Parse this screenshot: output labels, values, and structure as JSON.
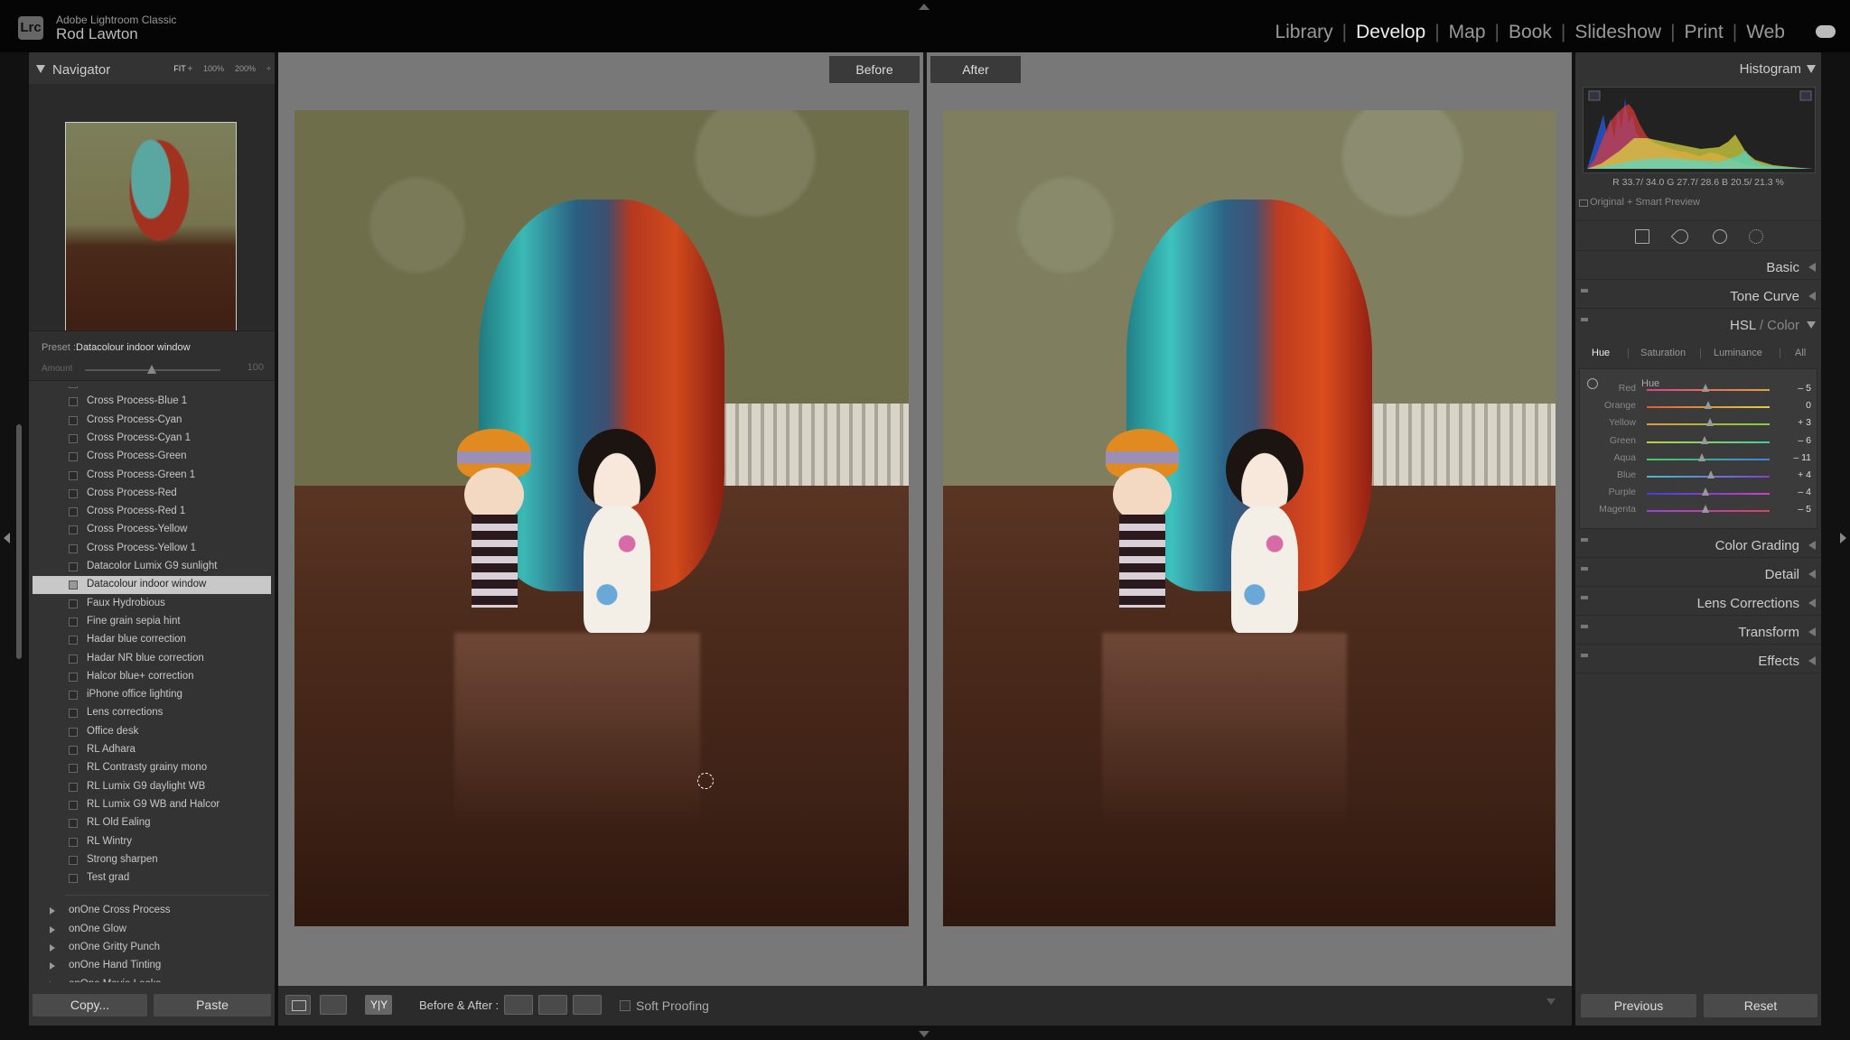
{
  "app": {
    "name": "Adobe Lightroom Classic",
    "user": "Rod Lawton",
    "logo_text": "Lrc"
  },
  "modules": [
    "Library",
    "Develop",
    "Map",
    "Book",
    "Slideshow",
    "Print",
    "Web"
  ],
  "active_module": "Develop",
  "navigator": {
    "title": "Navigator",
    "zoom_options": [
      "FIT ÷",
      "100%",
      "200%",
      "÷"
    ]
  },
  "preset": {
    "label": "Preset :",
    "name": "Datacolour indoor window",
    "amount_label": "Amount",
    "amount_value": "100"
  },
  "preset_items": [
    "Cross Process-Blue",
    "Cross Process-Blue 1",
    "Cross Process-Cyan",
    "Cross Process-Cyan 1",
    "Cross Process-Green",
    "Cross Process-Green 1",
    "Cross Process-Red",
    "Cross Process-Red 1",
    "Cross Process-Yellow",
    "Cross Process-Yellow 1",
    "Datacolor Lumix G9 sunlight",
    "Datacolour indoor window",
    "Faux Hydrobious",
    "Fine grain sepia hint",
    "Hadar blue correction",
    "Hadar NR blue correction",
    "Halcor blue+ correction",
    "iPhone office lighting",
    "Lens corrections",
    "Office desk",
    "RL Adhara",
    "RL Contrasty grainy mono",
    "RL Lumix G9 daylight WB",
    "RL Lumix G9 WB and Halcor",
    "RL Old Ealing",
    "RL Wintry",
    "Strong sharpen",
    "Test grad"
  ],
  "selected_preset": "Datacolour indoor window",
  "preset_groups": [
    "onOne Cross Process",
    "onOne Glow",
    "onOne Gritty Punch",
    "onOne Hand Tinting",
    "onOne Movie Looks"
  ],
  "left_buttons": {
    "copy": "Copy...",
    "paste": "Paste"
  },
  "view": {
    "before": "Before",
    "after": "After"
  },
  "toolbar": {
    "yy": "Y|Y",
    "before_after": "Before & After :",
    "soft_proofing": "Soft Proofing"
  },
  "histogram": {
    "title": "Histogram",
    "readout": "R  33.7/ 34.0   G  27.7/ 28.6   B  20.5/  21.3  %",
    "smart_preview": "Original + Smart Preview"
  },
  "sections": {
    "basic": "Basic",
    "tone_curve": "Tone Curve",
    "hsl": "HSL",
    "hsl_color": "/ Color",
    "color_grading": "Color Grading",
    "detail": "Detail",
    "lens": "Lens Corrections",
    "transform": "Transform",
    "effects": "Effects"
  },
  "hsl_tabs": [
    "Hue",
    "Saturation",
    "Luminance",
    "All"
  ],
  "hsl_active_tab": "Hue",
  "hsl_header": "Hue",
  "hue_sliders": [
    {
      "name": "Red",
      "value": -5,
      "display": "– 5",
      "color_from": "#e0408a",
      "color_to": "#e0a040"
    },
    {
      "name": "Orange",
      "value": 0,
      "display": "0",
      "color_from": "#e05a3a",
      "color_to": "#e0d040"
    },
    {
      "name": "Yellow",
      "value": 3,
      "display": "+ 3",
      "color_from": "#e09a40",
      "color_to": "#80d040"
    },
    {
      "name": "Green",
      "value": -6,
      "display": "– 6",
      "color_from": "#c0d040",
      "color_to": "#40d0a0"
    },
    {
      "name": "Aqua",
      "value": -11,
      "display": "– 11",
      "color_from": "#40d060",
      "color_to": "#4080e0"
    },
    {
      "name": "Blue",
      "value": 4,
      "display": "+ 4",
      "color_from": "#40c0d0",
      "color_to": "#8040e0"
    },
    {
      "name": "Purple",
      "value": -4,
      "display": "– 4",
      "color_from": "#4040e0",
      "color_to": "#d040c0"
    },
    {
      "name": "Magenta",
      "value": -5,
      "display": "– 5",
      "color_from": "#a040e0",
      "color_to": "#e04060"
    }
  ],
  "right_buttons": {
    "previous": "Previous",
    "reset": "Reset"
  }
}
